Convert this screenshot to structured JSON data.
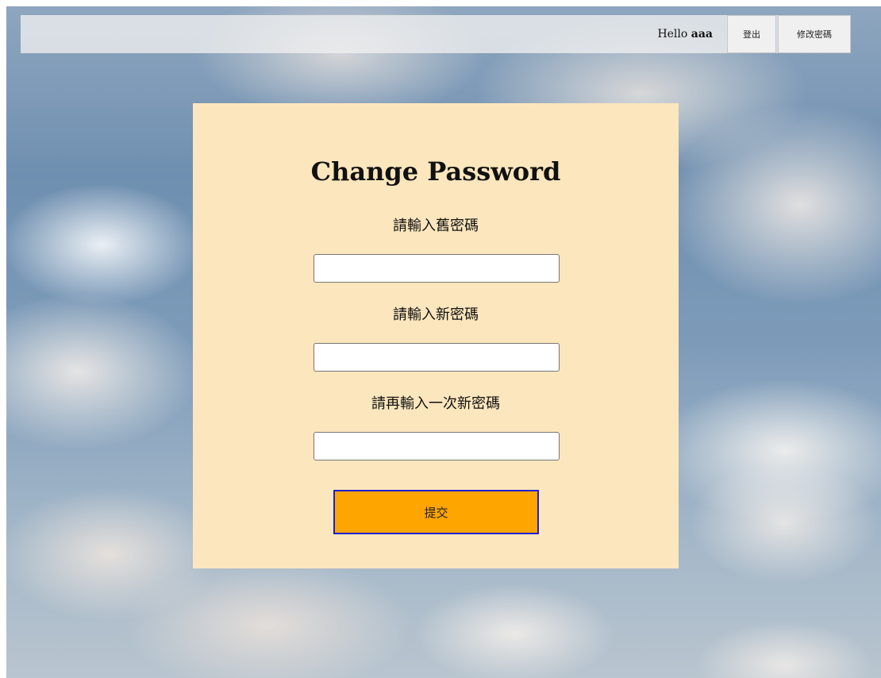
{
  "header": {
    "greeting_prefix": "Hello",
    "username": "aaa",
    "logout_label": "登出",
    "change_password_label": "修改密碼"
  },
  "form": {
    "title": "Change Password",
    "old_password_label": "請輸入舊密碼",
    "old_password_value": "",
    "new_password_label": "請輸入新密碼",
    "new_password_value": "",
    "confirm_password_label": "請再輸入一次新密碼",
    "confirm_password_value": "",
    "submit_label": "提交"
  },
  "colors": {
    "card_background": "#fce6bd",
    "submit_background": "#ffa500",
    "submit_border": "#1f1fd1"
  }
}
